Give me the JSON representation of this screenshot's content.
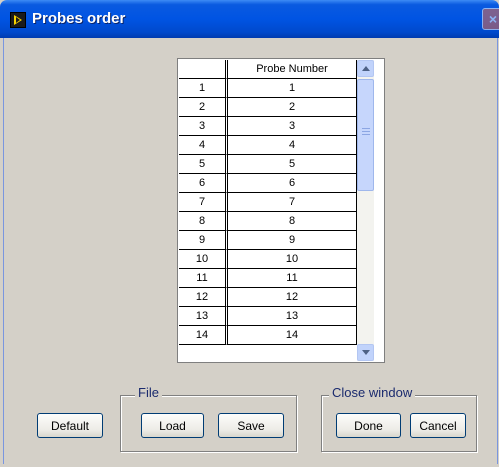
{
  "window": {
    "title": "Probes order",
    "close_glyph": "×"
  },
  "table": {
    "headers": [
      "",
      "Probe Number"
    ],
    "rows": [
      [
        "1",
        "1"
      ],
      [
        "2",
        "2"
      ],
      [
        "3",
        "3"
      ],
      [
        "4",
        "4"
      ],
      [
        "5",
        "5"
      ],
      [
        "6",
        "6"
      ],
      [
        "7",
        "7"
      ],
      [
        "8",
        "8"
      ],
      [
        "9",
        "9"
      ],
      [
        "10",
        "10"
      ],
      [
        "11",
        "11"
      ],
      [
        "12",
        "12"
      ],
      [
        "13",
        "13"
      ],
      [
        "14",
        "14"
      ]
    ]
  },
  "buttons": {
    "default": "Default",
    "load": "Load",
    "save": "Save",
    "done": "Done",
    "cancel": "Cancel"
  },
  "groups": {
    "file": "File",
    "close_window": "Close window"
  },
  "icons": {
    "app": "labview-run-icon",
    "scroll_up": "chevron-up-icon",
    "scroll_down": "chevron-down-icon"
  }
}
